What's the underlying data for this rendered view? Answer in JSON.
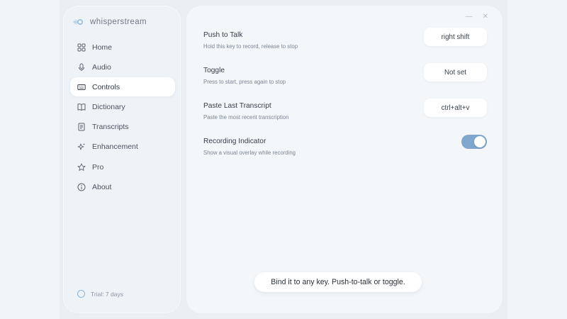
{
  "app": {
    "brand_name": "whisperstream"
  },
  "sidebar": {
    "items": [
      {
        "label": "Home",
        "icon": "grid-icon",
        "active": false
      },
      {
        "label": "Audio",
        "icon": "microphone-icon",
        "active": false
      },
      {
        "label": "Controls",
        "icon": "keyboard-icon",
        "active": true
      },
      {
        "label": "Dictionary",
        "icon": "book-icon",
        "active": false
      },
      {
        "label": "Transcripts",
        "icon": "document-icon",
        "active": false
      },
      {
        "label": "Enhancement",
        "icon": "sparkle-icon",
        "active": false
      },
      {
        "label": "Pro",
        "icon": "star-icon",
        "active": false
      },
      {
        "label": "About",
        "icon": "info-icon",
        "active": false
      }
    ],
    "trial_label": "Trial: 7 days"
  },
  "window": {
    "minimize": "—",
    "close": "✕"
  },
  "settings": {
    "push_to_talk": {
      "title": "Push to Talk",
      "desc": "Hold this key to record, release to stop",
      "value": "right shift"
    },
    "toggle": {
      "title": "Toggle",
      "desc": "Press to start, press again to stop",
      "value": "Not set"
    },
    "paste_last": {
      "title": "Paste Last Transcript",
      "desc": "Paste the most recent transcription",
      "value": "ctrl+alt+v"
    },
    "recording_indicator": {
      "title": "Recording Indicator",
      "desc": "Show a visual overlay while recording",
      "enabled": true
    }
  },
  "hint": {
    "text": "Bind it to any key. Push-to-talk or toggle."
  },
  "colors": {
    "accent": "#7ea6cf",
    "brand_logo": "#8bb4d8"
  }
}
